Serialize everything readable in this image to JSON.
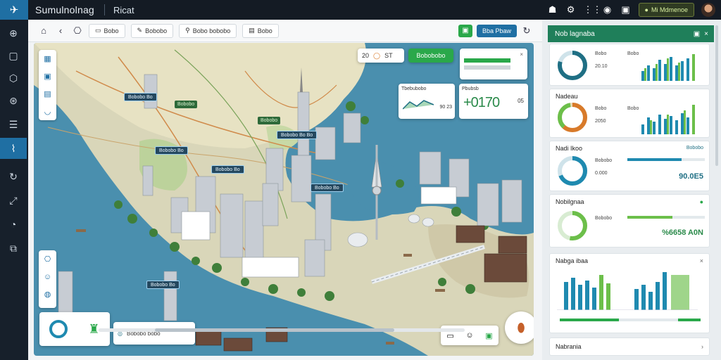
{
  "app": {
    "title": "Sumulnolnag",
    "subtitle": "Ricat"
  },
  "topbar": {
    "badge": "Mi Mdmenoe"
  },
  "toolbar": {
    "btn1": "Bobo",
    "btn2": "Bobobo",
    "btn3": "Bobo bobobo",
    "btn4": "Bobo",
    "right_button": "Bba Pbaw"
  },
  "map": {
    "scale_text": "20",
    "scale_unit": "ST",
    "green_label": "Bobobobo",
    "trend1_title": "Tbebubobo",
    "trend1_value": "90 23",
    "trend2_title": "Pbubsb",
    "trend2_value": "+0170",
    "trend2_pct": "05",
    "labels": [
      "Bobobo Bo",
      "Bobobo Bo",
      "Bobobo Bo Bo",
      "Bobobo Bo",
      "Bobobo Bo",
      "Bobobo Bo"
    ],
    "green_tags": [
      "Bobobo",
      "Bobobo"
    ],
    "bottom_mid_text": "Bobobo bobo"
  },
  "panel": {
    "header": "Nob lagnaba",
    "card1": {
      "title": "",
      "stat1": "Bobo",
      "stat2": "20.10",
      "stat3": "Bobo"
    },
    "card2": {
      "title": "Nadeau",
      "stat1": "Bobo",
      "stat2": "2050",
      "stat3": "Bobo"
    },
    "card3": {
      "title": "Nadi Ikoo",
      "meta": "Bobobo",
      "stat1": "Bobobo",
      "value": "90.0E5",
      "pct": "0.000"
    },
    "card4": {
      "title": "Nobilgnaa",
      "stat1": "Bobobo",
      "value": "%6658 A0N"
    },
    "card5": {
      "title": "Nabga ibaa"
    },
    "card6": {
      "title": "Nabrania"
    }
  },
  "colors": {
    "accent": "#1f6fa3",
    "green": "#2aa84a",
    "teal": "#1f6f84",
    "orange": "#d87a2a",
    "panel_header": "#1f7f5a"
  },
  "icons": {
    "rail": [
      "globe-icon",
      "chat-icon",
      "map-icon",
      "compass-icon",
      "list-icon",
      "route-icon",
      "refresh-icon",
      "expand-icon",
      "gauge-icon",
      "layers-icon"
    ]
  }
}
